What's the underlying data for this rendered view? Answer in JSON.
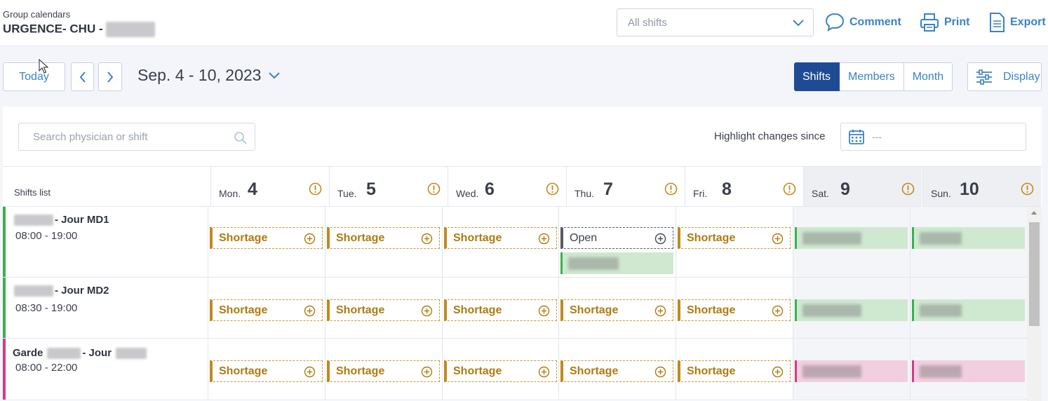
{
  "header": {
    "group_label": "Group calendars",
    "group_name": "URGENCE- CHU -",
    "shift_filter": "All shifts",
    "actions": {
      "comment": "Comment",
      "print": "Print",
      "export": "Export"
    }
  },
  "toolbar": {
    "today": "Today",
    "date_range": "Sep. 4 - 10, 2023",
    "views": [
      "Shifts",
      "Members",
      "Month"
    ],
    "active_view": "Shifts",
    "display": "Display"
  },
  "filters": {
    "search_placeholder": "Search physician or shift",
    "highlight_label": "Highlight changes since",
    "highlight_value": "---"
  },
  "calendar": {
    "list_header": "Shifts list",
    "days": [
      {
        "name": "Mon.",
        "num": "4",
        "weekend": false
      },
      {
        "name": "Tue.",
        "num": "5",
        "weekend": false
      },
      {
        "name": "Wed.",
        "num": "6",
        "weekend": false
      },
      {
        "name": "Thu.",
        "num": "7",
        "weekend": false
      },
      {
        "name": "Fri.",
        "num": "8",
        "weekend": false
      },
      {
        "name": "Sat.",
        "num": "9",
        "weekend": true
      },
      {
        "name": "Sun.",
        "num": "10",
        "weekend": true
      }
    ],
    "chip_labels": {
      "shortage": "Shortage",
      "open": "Open"
    },
    "rows": [
      {
        "title_prefix": "",
        "title_suffix": "- Jour MD1",
        "time": "08:00 - 19:00",
        "color": "#37b24d",
        "cells": [
          [
            "shortage"
          ],
          [
            "shortage"
          ],
          [
            "shortage"
          ],
          [
            "open",
            "assigned"
          ],
          [
            "shortage"
          ],
          [
            "assigned"
          ],
          [
            "assigned"
          ]
        ]
      },
      {
        "title_prefix": "",
        "title_suffix": "- Jour MD2",
        "time": "08:30 - 19:00",
        "color": "#37b24d",
        "cells": [
          [
            "shortage"
          ],
          [
            "shortage"
          ],
          [
            "shortage"
          ],
          [
            "shortage"
          ],
          [
            "shortage"
          ],
          [
            "assigned"
          ],
          [
            "assigned"
          ]
        ]
      },
      {
        "title_prefix": "Garde",
        "title_suffix": "- Jour",
        "time": "08:00 - 22:00",
        "color": "#d63a86",
        "cells": [
          [
            "shortage"
          ],
          [
            "shortage"
          ],
          [
            "shortage"
          ],
          [
            "shortage"
          ],
          [
            "shortage"
          ],
          [
            "assigned"
          ],
          [
            "assigned"
          ]
        ]
      }
    ]
  },
  "colors": {
    "accent": "#3b82c4",
    "active_tab": "#1f4b94",
    "shortage": "#b07a10",
    "warning_icon": "#c08a1e"
  },
  "icons": {
    "comment": "speech-bubble-icon",
    "print": "printer-icon",
    "export": "document-icon",
    "display": "sliders-icon",
    "search": "magnifier-icon",
    "calendar": "calendar-icon",
    "warning": "exclamation-circle-icon",
    "add": "plus-circle-icon"
  }
}
